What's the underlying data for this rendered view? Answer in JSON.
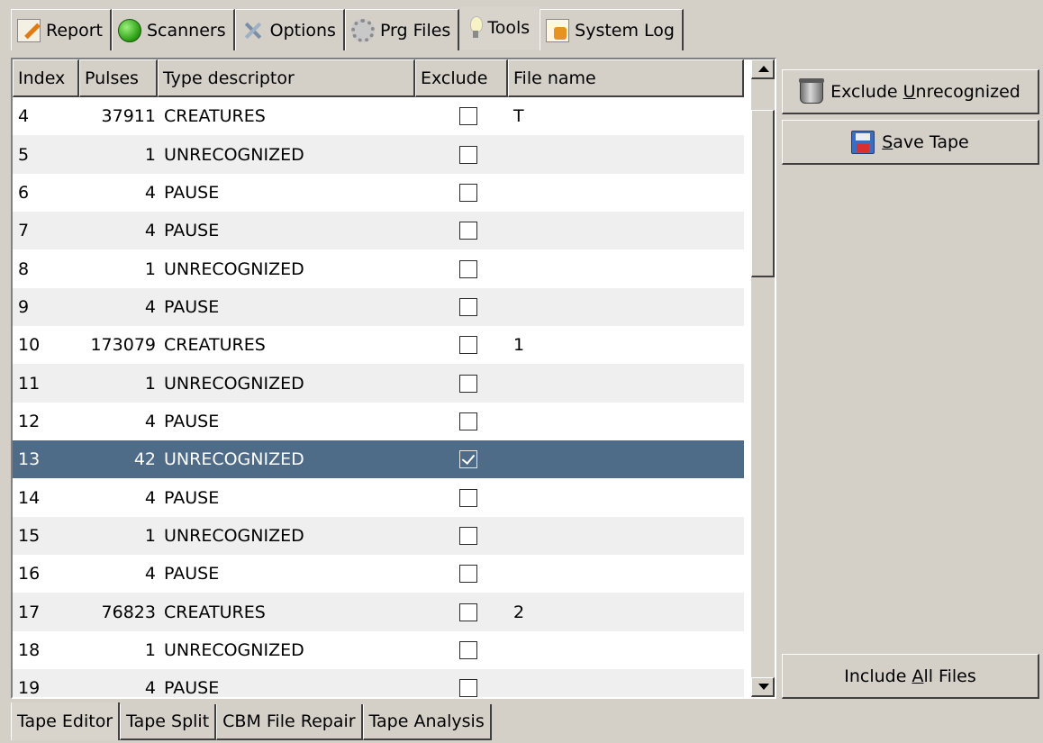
{
  "top_tabs": [
    {
      "label": "Report",
      "icon": "report-icon",
      "active": false
    },
    {
      "label": "Scanners",
      "icon": "scanner-icon",
      "active": false
    },
    {
      "label": "Options",
      "icon": "options-icon",
      "active": false
    },
    {
      "label": "Prg Files",
      "icon": "prg-files-icon",
      "active": false
    },
    {
      "label": "Tools",
      "icon": "tools-icon",
      "active": true
    },
    {
      "label": "System Log",
      "icon": "system-log-icon",
      "active": false
    }
  ],
  "table": {
    "columns": [
      "Index",
      "Pulses",
      "Type descriptor",
      "Exclude",
      "File name"
    ],
    "rows": [
      {
        "index": "4",
        "pulses": "37911",
        "type": "CREATURES",
        "exclude": false,
        "file": "T"
      },
      {
        "index": "5",
        "pulses": "1",
        "type": "UNRECOGNIZED",
        "exclude": false,
        "file": ""
      },
      {
        "index": "6",
        "pulses": "4",
        "type": "PAUSE",
        "exclude": false,
        "file": ""
      },
      {
        "index": "7",
        "pulses": "4",
        "type": "PAUSE",
        "exclude": false,
        "file": ""
      },
      {
        "index": "8",
        "pulses": "1",
        "type": "UNRECOGNIZED",
        "exclude": false,
        "file": ""
      },
      {
        "index": "9",
        "pulses": "4",
        "type": "PAUSE",
        "exclude": false,
        "file": ""
      },
      {
        "index": "10",
        "pulses": "173079",
        "type": "CREATURES",
        "exclude": false,
        "file": "1"
      },
      {
        "index": "11",
        "pulses": "1",
        "type": "UNRECOGNIZED",
        "exclude": false,
        "file": ""
      },
      {
        "index": "12",
        "pulses": "4",
        "type": "PAUSE",
        "exclude": false,
        "file": ""
      },
      {
        "index": "13",
        "pulses": "42",
        "type": "UNRECOGNIZED",
        "exclude": true,
        "file": "",
        "selected": true
      },
      {
        "index": "14",
        "pulses": "4",
        "type": "PAUSE",
        "exclude": false,
        "file": ""
      },
      {
        "index": "15",
        "pulses": "1",
        "type": "UNRECOGNIZED",
        "exclude": false,
        "file": ""
      },
      {
        "index": "16",
        "pulses": "4",
        "type": "PAUSE",
        "exclude": false,
        "file": ""
      },
      {
        "index": "17",
        "pulses": "76823",
        "type": "CREATURES",
        "exclude": false,
        "file": "2"
      },
      {
        "index": "18",
        "pulses": "1",
        "type": "UNRECOGNIZED",
        "exclude": false,
        "file": ""
      },
      {
        "index": "19",
        "pulses": "4",
        "type": "PAUSE",
        "exclude": false,
        "file": ""
      }
    ]
  },
  "buttons": {
    "exclude_pre": "Exclude ",
    "exclude_key": "U",
    "exclude_post": "nrecognized",
    "save_key": "S",
    "save_post": "ave Tape",
    "include_pre": "Include ",
    "include_key": "A",
    "include_post": "ll Files"
  },
  "bottom_tabs": [
    {
      "label": "Tape Editor",
      "active": true
    },
    {
      "label": "Tape Split",
      "active": false
    },
    {
      "label": "CBM File Repair",
      "active": false
    },
    {
      "label": "Tape Analysis",
      "active": false
    }
  ],
  "colors": {
    "selection": "#4e6b88",
    "background": "#d4d0c8"
  }
}
